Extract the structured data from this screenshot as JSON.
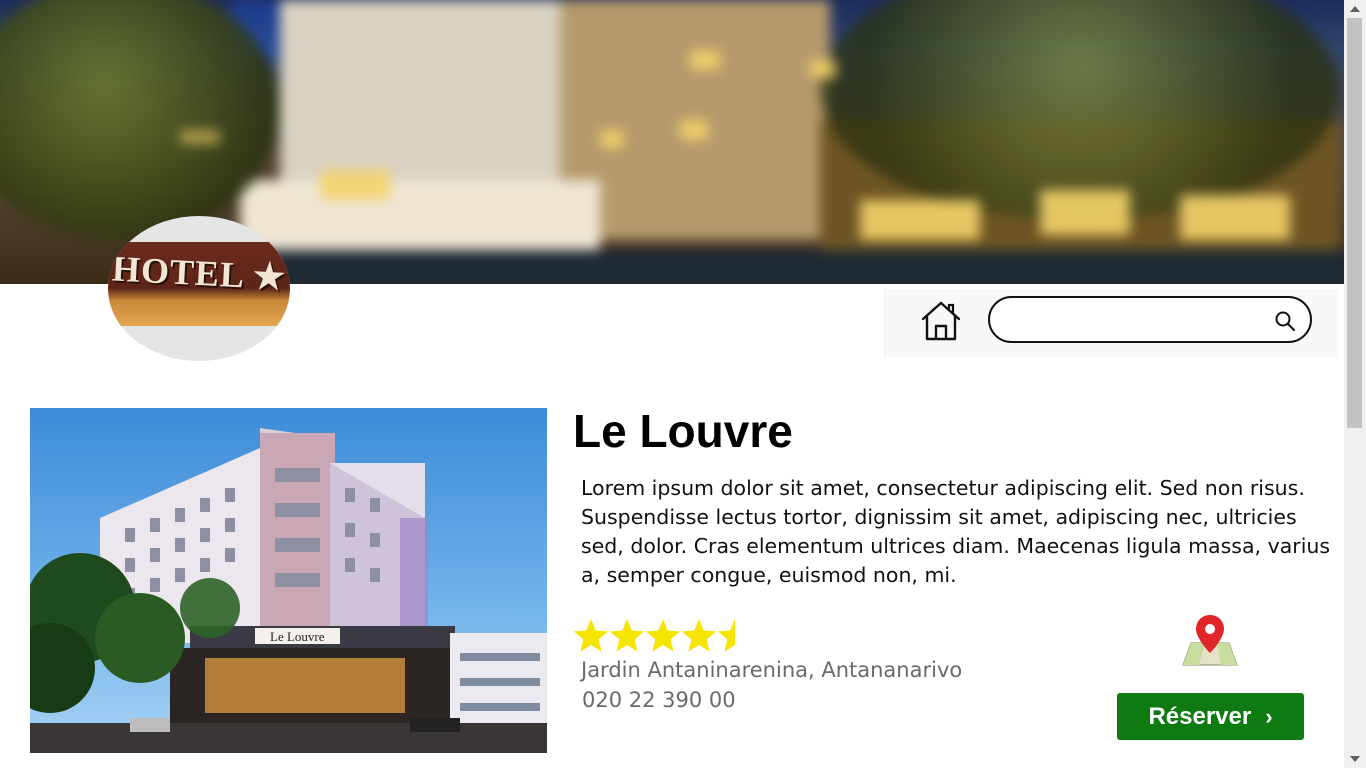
{
  "header": {
    "banner_image": "hotel-night-banner",
    "logo": {
      "text": "HOTEL",
      "icon": "star-icon"
    }
  },
  "toolbar": {
    "home_icon": "home-icon",
    "search": {
      "value": "",
      "placeholder": "",
      "icon": "search-icon"
    }
  },
  "hotel": {
    "name": "Le Louvre",
    "description": "Lorem ipsum dolor sit amet, consectetur adipiscing elit. Sed non risus. Suspendisse lectus tortor, dignissim sit amet, adipiscing nec, ultricies sed, dolor. Cras elementum ultrices diam. Maecenas ligula massa, varius a, semper congue, euismod non, mi.",
    "rating": 4.5,
    "rating_max": 5,
    "address": "Jardin Antaninarenina, Antananarivo",
    "phone": "020 22 390 00",
    "photo_sign": "Le Louvre",
    "map_icon": "map-pin-icon",
    "reserve_label": "Réserver",
    "reserve_icon": "chevron-right-icon"
  },
  "colors": {
    "reserve_button": "#0d7a12",
    "star": "#f5e500",
    "map_pin": "#e0262b",
    "muted_text": "#6a6a6a"
  }
}
